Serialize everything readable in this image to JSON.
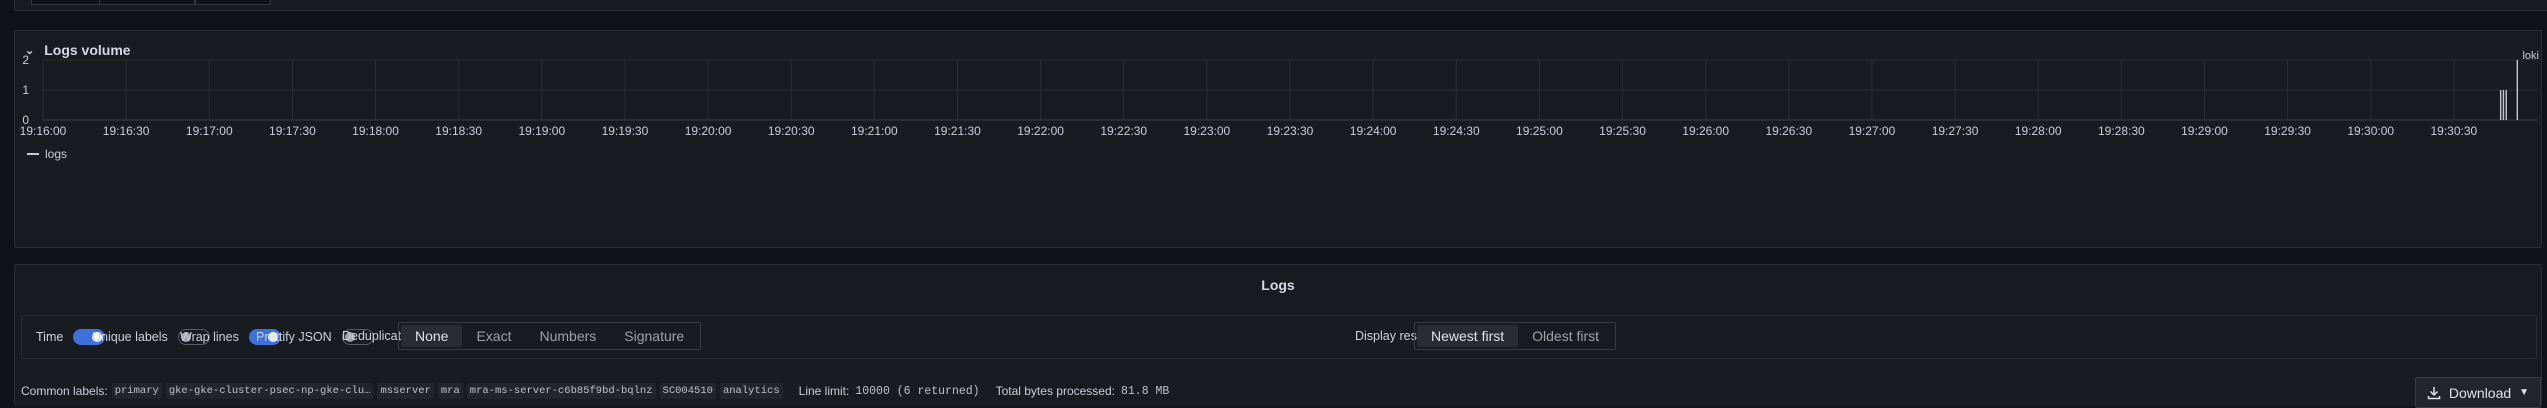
{
  "volume_panel": {
    "title": "Logs volume",
    "chevron": "chevron-down-icon"
  },
  "chart_data": {
    "type": "bar",
    "datasource": "loki",
    "x_range": [
      "19:16:00",
      "19:31:00"
    ],
    "y_ticks": [
      "0",
      "1",
      "2"
    ],
    "ylim": [
      0,
      2
    ],
    "x_ticks": [
      "19:16:00",
      "19:16:30",
      "19:17:00",
      "19:17:30",
      "19:18:00",
      "19:18:30",
      "19:19:00",
      "19:19:30",
      "19:20:00",
      "19:20:30",
      "19:21:00",
      "19:21:30",
      "19:22:00",
      "19:22:30",
      "19:23:00",
      "19:23:30",
      "19:24:00",
      "19:24:30",
      "19:25:00",
      "19:25:30",
      "19:26:00",
      "19:26:30",
      "19:27:00",
      "19:27:30",
      "19:28:00",
      "19:28:30",
      "19:29:00",
      "19:29:30",
      "19:30:00",
      "19:30:30"
    ],
    "series": [
      {
        "name": "logs",
        "color": "#c7c9d1",
        "x": [
          "19:30:47",
          "19:30:48",
          "19:30:49",
          "19:30:53"
        ],
        "values": [
          1,
          1,
          1,
          2
        ]
      }
    ],
    "legend_position": "bottom-left",
    "grid": true
  },
  "logs_panel": {
    "title": "Logs",
    "options": {
      "time": {
        "label": "Time",
        "on": true
      },
      "unique_labels": {
        "label": "Unique labels",
        "on": false
      },
      "wrap_lines": {
        "label": "Wrap lines",
        "on": true
      },
      "prettify_json": {
        "label": "Prettify JSON",
        "on": false
      },
      "dedup": {
        "label": "Deduplication",
        "options": [
          "None",
          "Exact",
          "Numbers",
          "Signature"
        ],
        "selected": "None"
      },
      "display": {
        "label": "Display results",
        "options": [
          "Newest first",
          "Oldest first"
        ],
        "selected": "Newest first"
      }
    },
    "meta": {
      "common_labels_label": "Common labels:",
      "common_labels": [
        "primary",
        "gke-gke-cluster-psec-np-gke-clu…",
        "msserver",
        "mra",
        "mra-ms-server-c6b85f9bd-bqlnz",
        "SC004510",
        "analytics"
      ],
      "line_limit_label": "Line limit:",
      "line_limit_value": "10000 (6 returned)",
      "bytes_label": "Total bytes processed:",
      "bytes_value": "81.8 MB"
    },
    "download": {
      "label": "Download",
      "icon": "download-icon",
      "caret": "chevron-down-icon"
    }
  }
}
